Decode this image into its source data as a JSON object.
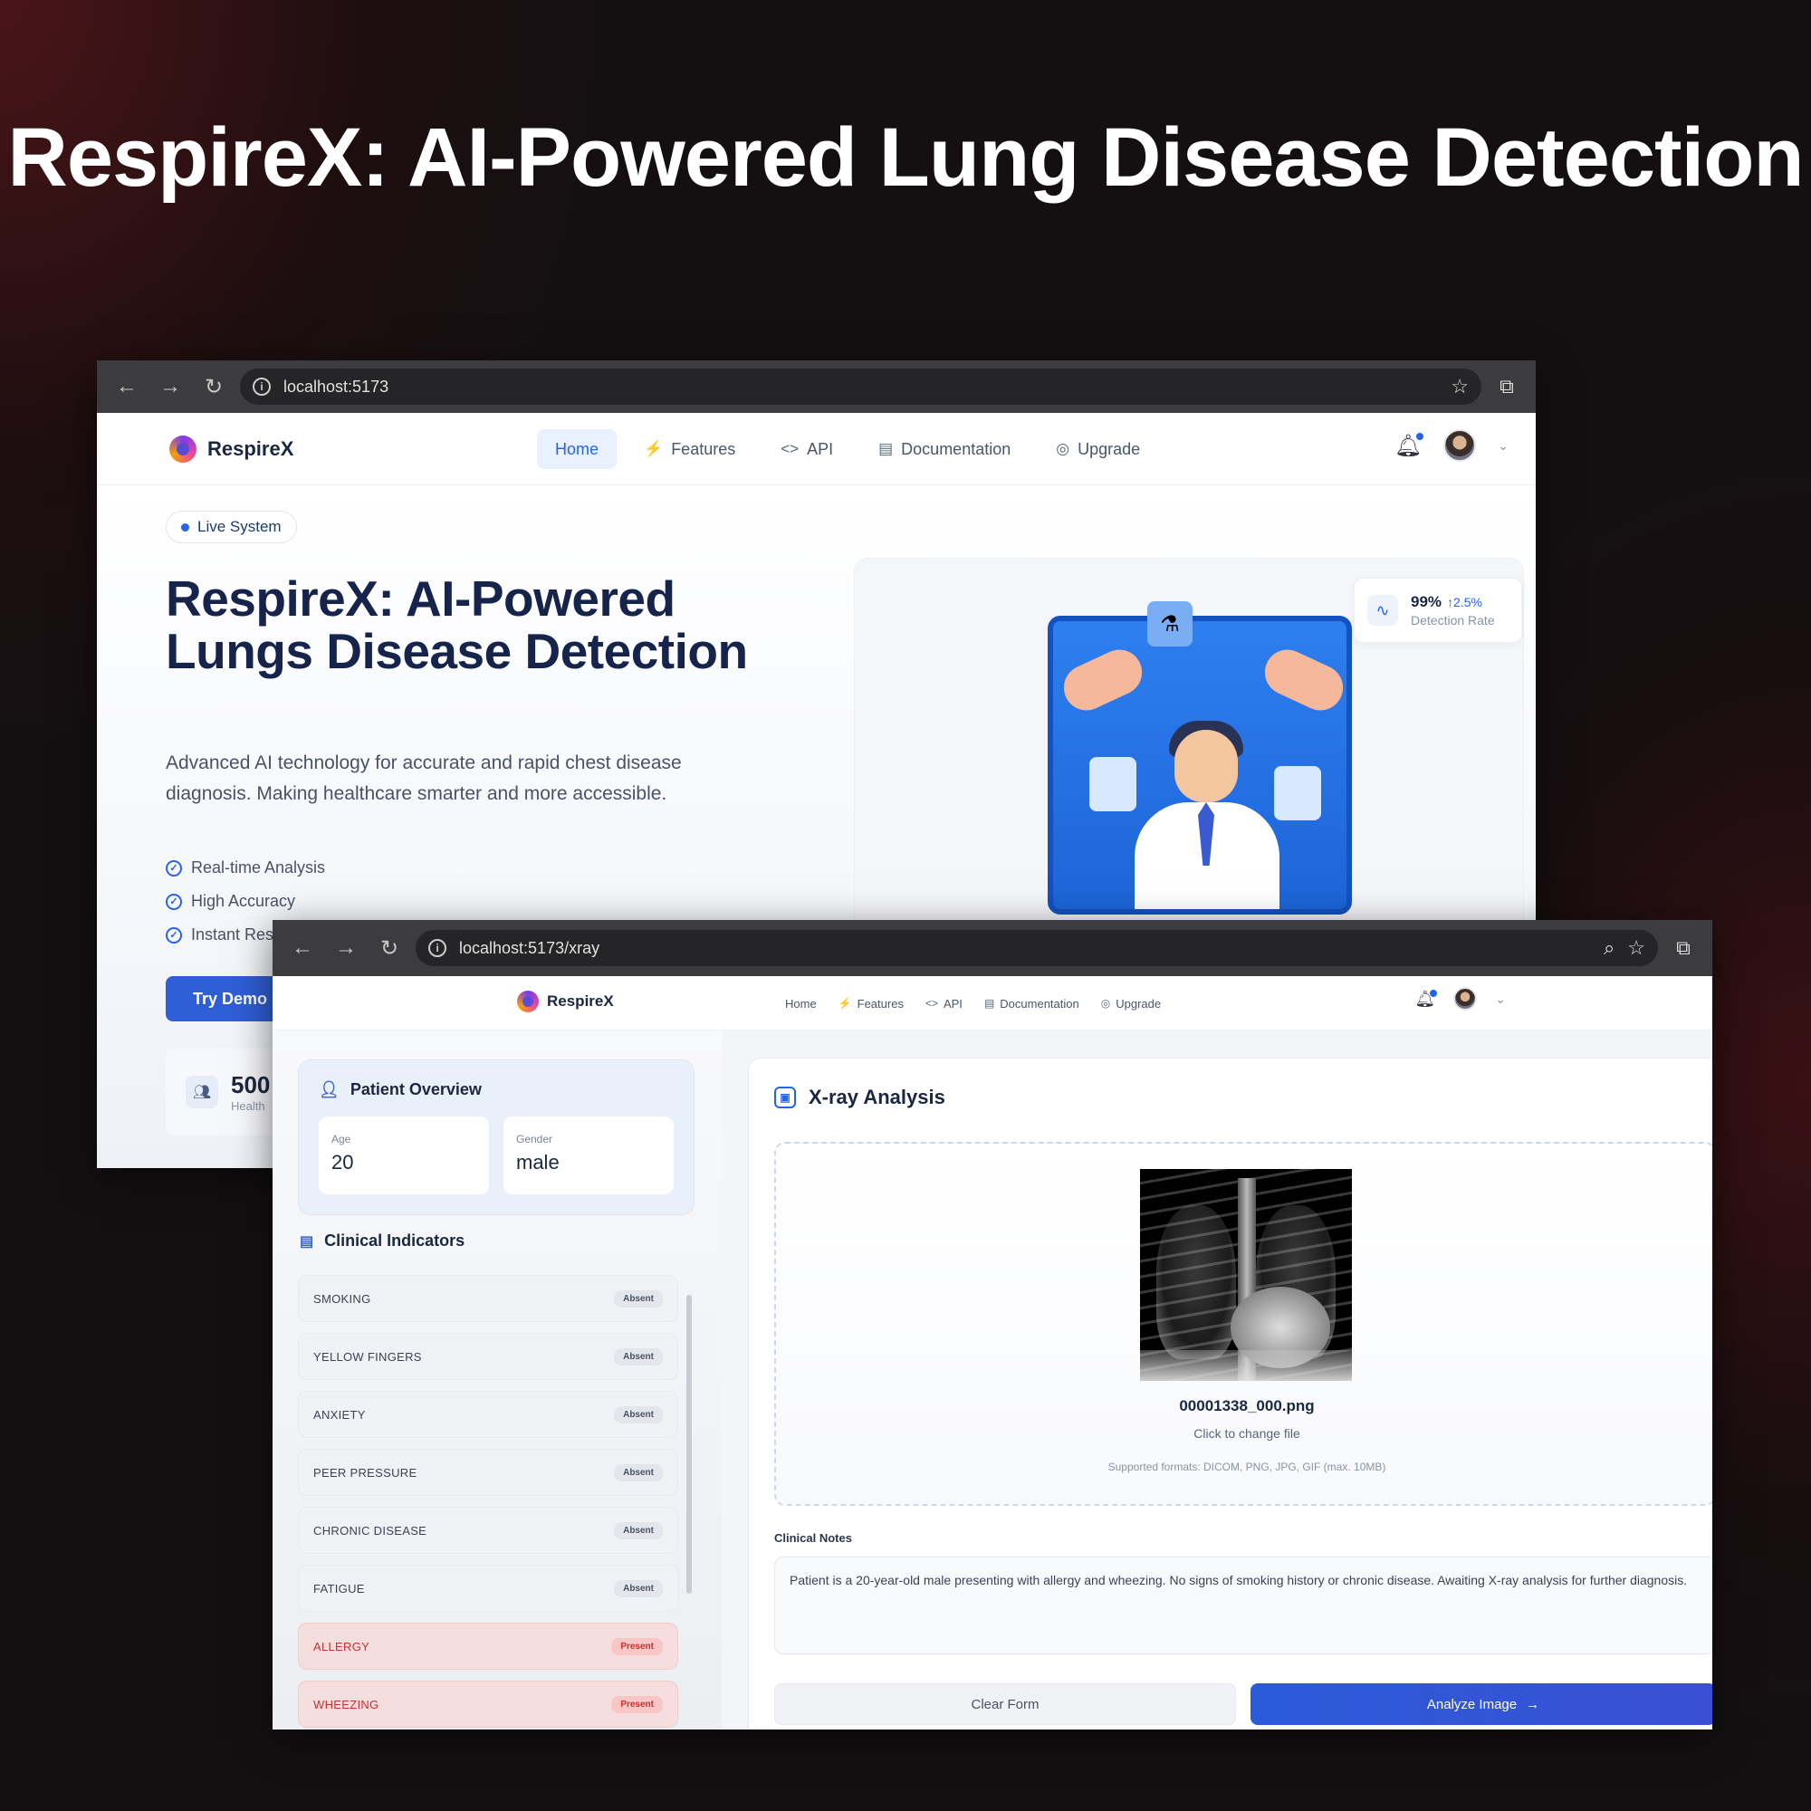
{
  "page_title": "RespireX: AI-Powered Lung Disease Detection",
  "window1": {
    "url": "localhost:5173",
    "brand": "RespireX",
    "menu": [
      {
        "label": "Home",
        "icon": "",
        "active": true
      },
      {
        "label": "Features",
        "icon": "⚡",
        "active": false
      },
      {
        "label": "API",
        "icon": "<>",
        "active": false
      },
      {
        "label": "Documentation",
        "icon": "▤",
        "active": false
      },
      {
        "label": "Upgrade",
        "icon": "◎",
        "active": false
      }
    ],
    "badge": "Live System",
    "hero_title": "RespireX: AI-Powered Lungs Disease Detection",
    "hero_subtitle": "Advanced AI technology for accurate and rapid chest disease diagnosis. Making healthcare smarter and more accessible.",
    "checks": [
      "Real-time Analysis",
      "High Accuracy",
      "Instant Res"
    ],
    "cta": "Try Demo",
    "stat_value": "500",
    "stat_label": "Health",
    "detection_value": "99%",
    "detection_change": "↑2.5%",
    "detection_label": "Detection Rate"
  },
  "window2": {
    "url": "localhost:5173/xray",
    "brand": "RespireX",
    "menu": [
      {
        "label": "Home",
        "icon": ""
      },
      {
        "label": "Features",
        "icon": "⚡"
      },
      {
        "label": "API",
        "icon": "<>"
      },
      {
        "label": "Documentation",
        "icon": "▤"
      },
      {
        "label": "Upgrade",
        "icon": "◎"
      }
    ],
    "patient_overview": {
      "title": "Patient Overview",
      "age_label": "Age",
      "age": "20",
      "gender_label": "Gender",
      "gender": "male"
    },
    "clinical_indicators_title": "Clinical Indicators",
    "indicators": [
      {
        "name": "SMOKING",
        "status": "Absent",
        "present": false
      },
      {
        "name": "YELLOW FINGERS",
        "status": "Absent",
        "present": false
      },
      {
        "name": "ANXIETY",
        "status": "Absent",
        "present": false
      },
      {
        "name": "PEER PRESSURE",
        "status": "Absent",
        "present": false
      },
      {
        "name": "CHRONIC DISEASE",
        "status": "Absent",
        "present": false
      },
      {
        "name": "FATIGUE",
        "status": "Absent",
        "present": false
      },
      {
        "name": "ALLERGY",
        "status": "Present",
        "present": true
      },
      {
        "name": "WHEEZING",
        "status": "Present",
        "present": true
      }
    ],
    "xray_title": "X-ray Analysis",
    "file_name": "00001338_000.png",
    "change_file": "Click to change file",
    "formats": "Supported formats: DICOM, PNG, JPG, GIF (max. 10MB)",
    "clinical_notes_label": "Clinical Notes",
    "clinical_notes": "Patient is a 20-year-old male presenting with allergy and wheezing. No signs of smoking history or chronic disease. Awaiting X-ray analysis for further diagnosis.",
    "clear_button": "Clear Form",
    "analyze_button": "Analyze Image"
  }
}
